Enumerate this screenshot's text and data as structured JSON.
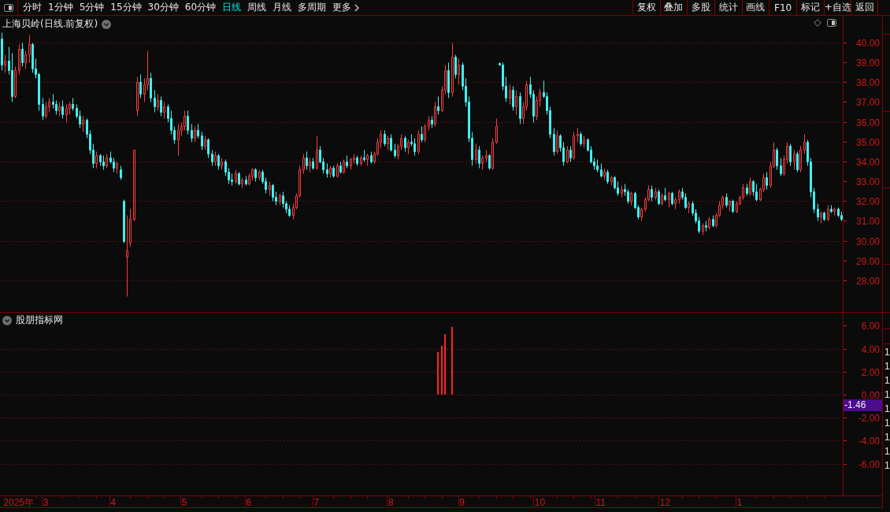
{
  "toolbar": {
    "periods": [
      {
        "label": "分时",
        "selected": false
      },
      {
        "label": "1分钟",
        "selected": false
      },
      {
        "label": "5分钟",
        "selected": false
      },
      {
        "label": "15分钟",
        "selected": false
      },
      {
        "label": "30分钟",
        "selected": false
      },
      {
        "label": "60分钟",
        "selected": false
      },
      {
        "label": "日线",
        "selected": true
      },
      {
        "label": "周线",
        "selected": false
      },
      {
        "label": "月线",
        "selected": false
      },
      {
        "label": "多周期",
        "selected": false
      }
    ],
    "more": "更多",
    "buttons": [
      "复权",
      "叠加",
      "多股",
      "统计",
      "画线",
      "F10",
      "标记",
      "+自选",
      "返回"
    ]
  },
  "price_panel": {
    "title": "上海贝岭(日线.前复权)",
    "axis_labels": [
      "40.00",
      "39.00",
      "38.00",
      "37.00",
      "36.00",
      "35.00",
      "34.00",
      "33.00",
      "32.00",
      "31.00",
      "30.00",
      "29.00",
      "28.00"
    ]
  },
  "indicator_panel": {
    "title": "股朋指标网",
    "value_label": "-1.46",
    "chart_data": {
      "type": "bar",
      "grid": true,
      "ylim": [
        -8.77,
        7.12
      ],
      "yticks": [
        {
          "value": 6,
          "label": "6.00"
        },
        {
          "value": 4,
          "label": "4.00"
        },
        {
          "value": 2,
          "label": "2.00"
        },
        {
          "value": 0,
          "label": "0.00"
        },
        {
          "value": -2,
          "label": "-2.00"
        },
        {
          "value": -4,
          "label": "-4.00"
        },
        {
          "value": -6,
          "label": "-6.00"
        }
      ],
      "categories": [
        null,
        null,
        null,
        null,
        null,
        "2025年",
        null,
        null,
        null,
        null,
        null,
        null,
        null,
        "3",
        null,
        null,
        null,
        null,
        null,
        null,
        null,
        null,
        null,
        null,
        null,
        null,
        null,
        null,
        null,
        null,
        null,
        null,
        null,
        "4",
        null,
        null,
        null,
        null,
        null,
        null,
        null,
        null,
        null,
        null,
        null,
        null,
        null,
        null,
        null,
        null,
        null,
        null,
        null,
        null,
        "5",
        null,
        null,
        null,
        null,
        null,
        null,
        null,
        null,
        null,
        null,
        null,
        null,
        null,
        null,
        null,
        null,
        null,
        null,
        "6",
        null,
        null,
        null,
        null,
        null,
        null,
        null,
        null,
        null,
        null,
        null,
        null,
        null,
        null,
        null,
        null,
        null,
        null,
        null,
        "7",
        null,
        null,
        null,
        null,
        null,
        null,
        null,
        null,
        null,
        null,
        null,
        null,
        null,
        null,
        null,
        null,
        null,
        null,
        null,
        null,
        null,
        "8",
        null,
        null,
        null,
        null,
        null,
        null,
        null,
        null,
        null,
        null,
        null,
        null,
        null,
        null,
        null,
        null,
        null,
        null,
        null,
        null,
        "9",
        null,
        null,
        null,
        null,
        null,
        null,
        null,
        null,
        null,
        null,
        null,
        null,
        null,
        null,
        null,
        null,
        null,
        null,
        null,
        null,
        null,
        null,
        "10",
        null,
        null,
        null,
        null,
        null,
        null,
        null,
        null,
        null,
        null,
        null,
        null,
        null,
        null,
        null,
        null,
        null,
        "11",
        null,
        null,
        null,
        null,
        null,
        null,
        null,
        null,
        null,
        null,
        null,
        null,
        null,
        null,
        null,
        null,
        null,
        null,
        "12",
        null,
        null,
        null,
        null,
        null,
        null,
        null,
        null,
        null,
        null,
        null,
        null,
        null,
        null,
        null,
        null,
        null,
        null,
        null,
        null,
        null,
        "1",
        null,
        null,
        null,
        null,
        null,
        null,
        null,
        null,
        null,
        null,
        null,
        null,
        null,
        null,
        null,
        null,
        null,
        null,
        null,
        null,
        null,
        null,
        null,
        null,
        null,
        null,
        null,
        null,
        null,
        null
      ],
      "values": [
        0,
        0,
        0,
        0,
        0,
        0,
        0,
        0,
        0,
        0,
        0,
        0,
        0,
        0,
        0,
        0,
        0,
        0,
        0,
        0,
        0,
        0,
        0,
        0,
        0,
        0,
        0,
        0,
        0,
        0,
        0,
        0,
        0,
        0,
        0,
        0,
        0,
        0,
        0,
        0,
        0,
        0,
        0,
        0,
        0,
        0,
        0,
        0,
        0,
        0,
        0,
        0,
        0,
        0,
        0,
        0,
        0,
        0,
        0,
        0,
        0,
        0,
        0,
        0,
        0,
        0,
        0,
        0,
        0,
        0,
        0,
        0,
        0,
        0,
        0,
        0,
        0,
        0,
        0,
        0,
        0,
        0,
        0,
        0,
        0,
        0,
        0,
        0,
        0,
        0,
        0,
        0,
        0,
        0,
        0,
        0,
        0,
        0,
        0,
        0,
        0,
        0,
        0,
        0,
        0,
        0,
        0,
        0,
        0,
        0,
        0,
        0,
        0,
        0,
        0,
        0,
        0,
        0,
        0,
        0,
        0,
        0,
        0,
        0,
        0,
        0,
        0,
        0,
        0,
        3.7,
        4.25,
        5.25,
        0,
        5.9,
        0,
        0,
        0,
        0,
        0,
        0,
        0,
        0,
        0,
        0,
        0,
        0,
        0,
        0,
        0,
        0,
        0,
        0,
        0,
        0,
        0,
        0,
        0,
        0,
        0,
        0,
        0,
        0,
        0,
        0,
        0,
        0,
        0,
        0,
        0,
        0,
        0,
        0,
        0,
        0,
        0,
        0,
        0,
        0,
        0,
        0,
        0,
        0,
        0,
        0,
        0,
        0,
        0,
        0,
        0,
        0,
        0,
        0,
        0,
        0,
        0,
        0,
        0,
        0,
        0,
        0,
        0,
        0,
        0,
        0,
        0,
        0,
        0,
        0,
        0,
        0,
        0,
        0,
        0,
        0,
        0,
        0,
        0,
        0,
        0,
        0,
        0,
        0,
        0,
        0,
        0,
        0,
        0,
        0,
        0,
        0,
        0,
        0,
        0,
        0,
        0,
        0,
        0,
        0,
        0,
        0,
        0,
        0,
        0,
        0,
        0,
        0,
        0,
        0,
        0
      ]
    }
  },
  "side_column": {
    "values": [
      "1",
      "1",
      "1",
      "1",
      "1",
      "1",
      "1",
      "1",
      "1"
    ]
  }
}
